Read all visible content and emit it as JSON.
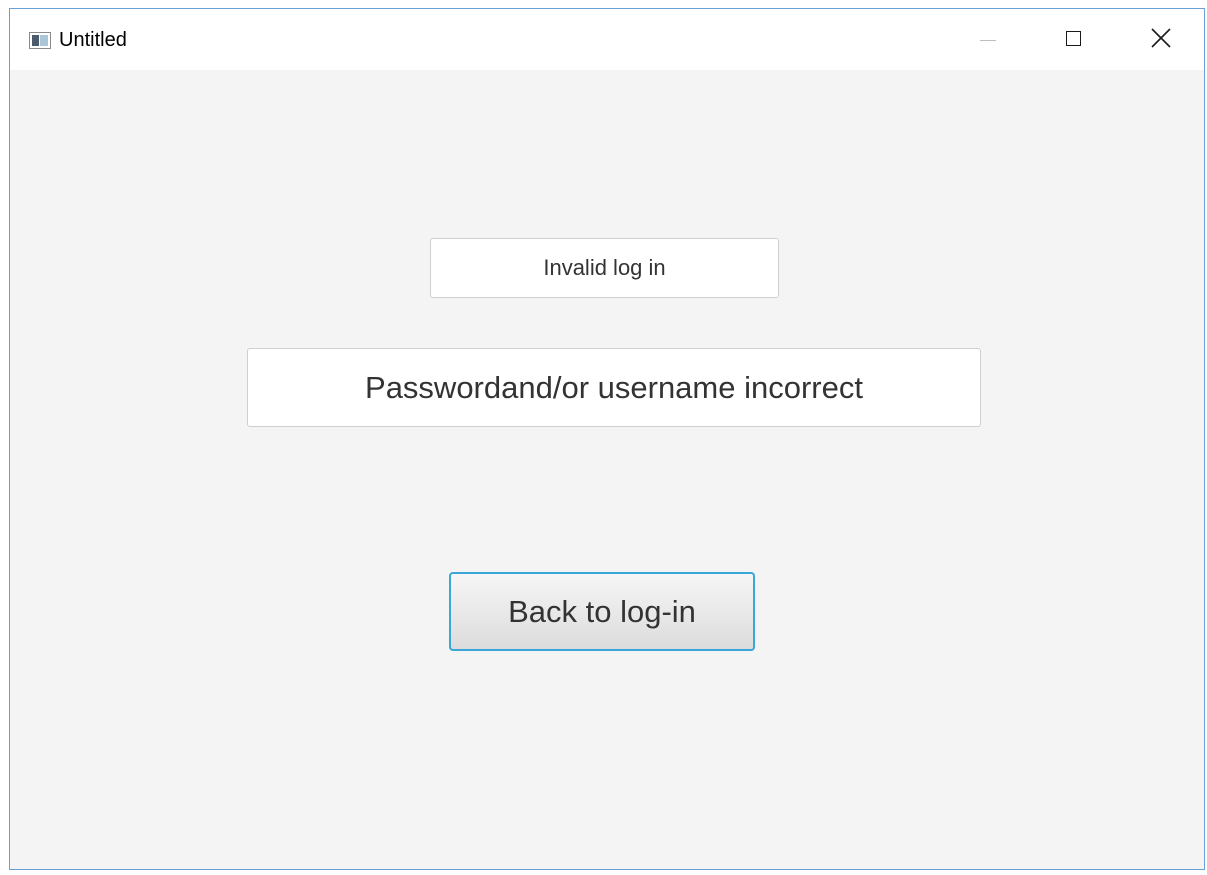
{
  "window": {
    "title": "Untitled",
    "controls": {
      "minimize_icon": "minimize-icon",
      "maximize_icon": "maximize-icon",
      "close_icon": "close-icon"
    }
  },
  "main": {
    "status_label": "Invalid log in",
    "error_message": "Passwordand/or username incorrect",
    "back_button_label": "Back to log-in"
  },
  "colors": {
    "background": "#f4f4f4",
    "button_focus_border": "#3ba6d8",
    "window_border": "#6a9fd8"
  }
}
